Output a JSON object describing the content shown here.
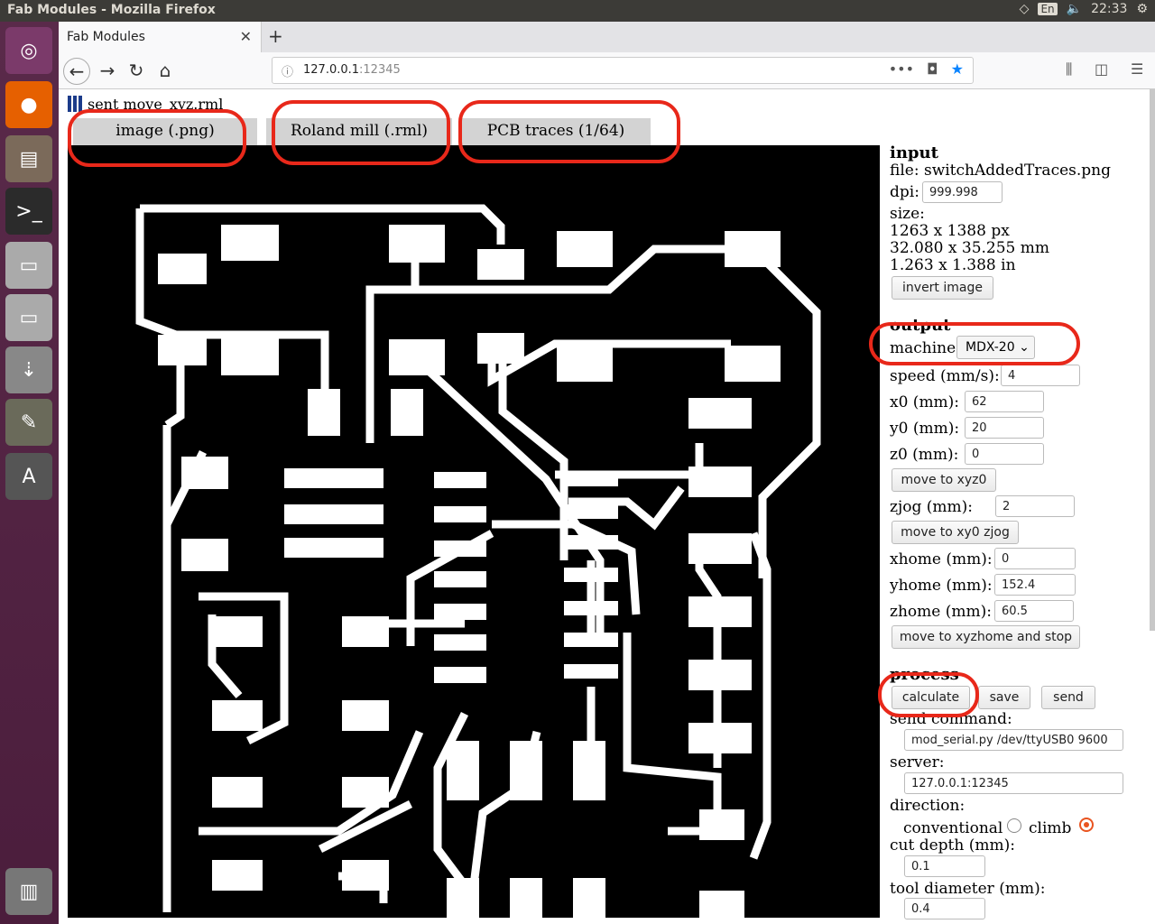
{
  "window": {
    "title": "Fab Modules - Mozilla Firefox",
    "language_indicator": "En",
    "volume_icon": "volume-icon",
    "clock": "22:33",
    "settings_icon": "gear-icon"
  },
  "launcher": {
    "items": [
      "ubuntu-dash",
      "firefox",
      "file-manager",
      "terminal",
      "drive",
      "drive-2",
      "usb-drive",
      "gimp",
      "software-updater",
      "trash"
    ]
  },
  "browser": {
    "tab_title": "Fab Modules",
    "new_tab_label": "+",
    "url_host": "127.0.0.1",
    "url_port": ":12345",
    "url_actions": "•••"
  },
  "page": {
    "status_text": "sent move_xyz.rml",
    "module_tabs": [
      {
        "label": "image (.png)"
      },
      {
        "label": "Roland mill (.rml)"
      },
      {
        "label": "PCB traces (1/64)"
      }
    ],
    "input": {
      "heading": "input",
      "file_label": "file: switchAddedTraces.png",
      "dpi_label": "dpi:",
      "dpi_value": "999.998",
      "size_label": "size:",
      "size_px": "1263 x 1388 px",
      "size_mm": "32.080 x 35.255 mm",
      "size_in": "1.263 x 1.388 in",
      "invert_button": "invert image"
    },
    "output": {
      "heading": "output",
      "machine_label": "machine",
      "machine_value": "MDX-20",
      "speed_label": "speed (mm/s):",
      "speed_value": "4",
      "x0_label": "x0 (mm):",
      "x0_value": "62",
      "y0_label": "y0 (mm):",
      "y0_value": "20",
      "z0_label": "z0 (mm):",
      "z0_value": "0",
      "move_xyz0_button": "move to xyz0",
      "zjog_label": "zjog (mm):",
      "zjog_value": "2",
      "move_xy0_button": "move to xy0 zjog",
      "xhome_label": "xhome (mm):",
      "xhome_value": "0",
      "yhome_label": "yhome (mm):",
      "yhome_value": "152.4",
      "zhome_label": "zhome (mm):",
      "zhome_value": "60.5",
      "move_home_button": "move to xyzhome and stop"
    },
    "process": {
      "heading": "process",
      "calculate_button": "calculate",
      "save_button": "save",
      "send_button": "send",
      "send_command_label": "send command:",
      "send_command_value": "mod_serial.py /dev/ttyUSB0 9600",
      "server_label": "server:",
      "server_value": "127.0.0.1:12345",
      "direction_label": "direction:",
      "conventional_label": "conventional",
      "climb_label": "climb",
      "direction_selected": "climb",
      "cut_depth_label": "cut depth (mm):",
      "cut_depth_value": "0.1",
      "tool_diameter_label": "tool diameter (mm):",
      "tool_diameter_value": "0.4"
    }
  },
  "colors": {
    "annotation_red": "#e8281a",
    "launcher_purple": "#5a2a4a",
    "trace_white": "#ffffff",
    "board_black": "#000000"
  }
}
